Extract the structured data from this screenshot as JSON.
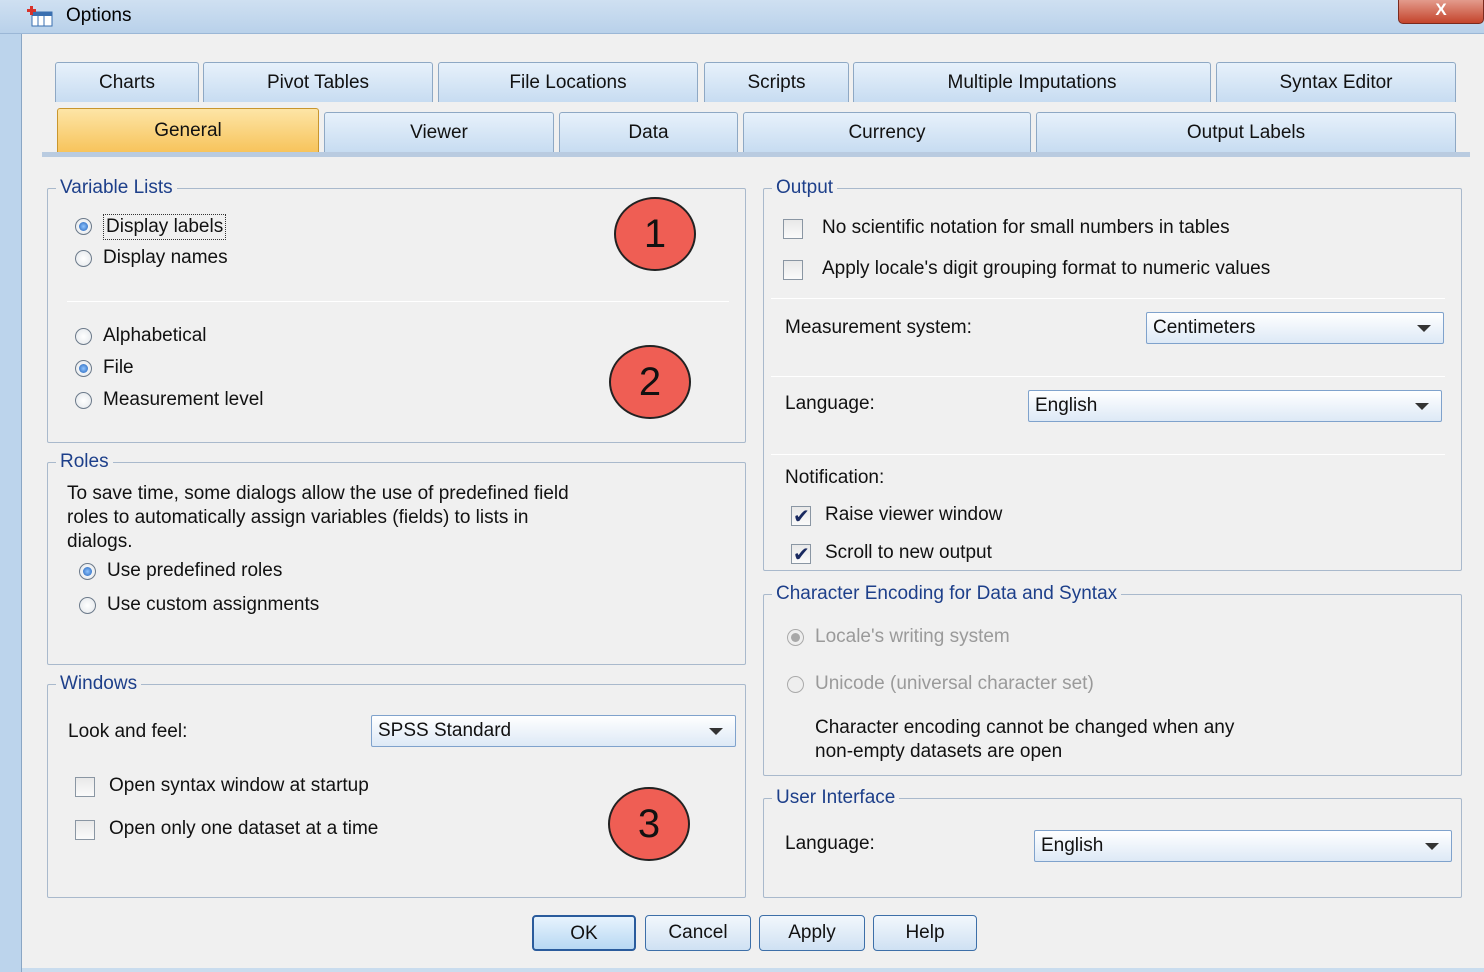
{
  "window": {
    "title": "Options",
    "close_label": "X"
  },
  "tabs_row1": [
    "Charts",
    "Pivot Tables",
    "File Locations",
    "Scripts",
    "Multiple Imputations",
    "Syntax Editor"
  ],
  "tabs_row2": [
    "General",
    "Viewer",
    "Data",
    "Currency",
    "Output Labels"
  ],
  "active_tab": "General",
  "variable_lists": {
    "title": "Variable Lists",
    "display_labels": "Display labels",
    "display_names": "Display names",
    "alphabetical": "Alphabetical",
    "file": "File",
    "measurement_level": "Measurement level"
  },
  "roles": {
    "title": "Roles",
    "description_lines": [
      "To save time, some dialogs allow the use of predefined field",
      "roles to automatically assign variables (fields) to lists in",
      "dialogs."
    ],
    "use_predefined": "Use predefined roles",
    "use_custom": "Use custom assignments"
  },
  "windows": {
    "title": "Windows",
    "look_feel_label": "Look and feel:",
    "look_feel_value": "SPSS Standard",
    "open_syntax": "Open syntax window at startup",
    "open_one_dataset": "Open only one dataset at a time"
  },
  "output": {
    "title": "Output",
    "no_scientific": "No scientific notation for small numbers in tables",
    "apply_locale": "Apply locale's digit  grouping format to numeric values",
    "measurement_label": "Measurement system:",
    "measurement_value": "Centimeters",
    "language_label": "Language:",
    "language_value": "English",
    "notification_label": "Notification:",
    "raise_viewer": "Raise viewer window",
    "scroll_output": "Scroll to new output"
  },
  "encoding": {
    "title": "Character Encoding for Data and Syntax",
    "locale_writing": "Locale's writing system",
    "unicode": "Unicode (universal character set)",
    "note_lines": [
      "Character encoding cannot be changed when any",
      "non-empty datasets are open"
    ]
  },
  "user_interface": {
    "title": "User Interface",
    "language_label": "Language:",
    "language_value": "English"
  },
  "markers": [
    "1",
    "2",
    "3"
  ],
  "buttons": {
    "ok": "OK",
    "cancel": "Cancel",
    "apply": "Apply",
    "help": "Help"
  }
}
